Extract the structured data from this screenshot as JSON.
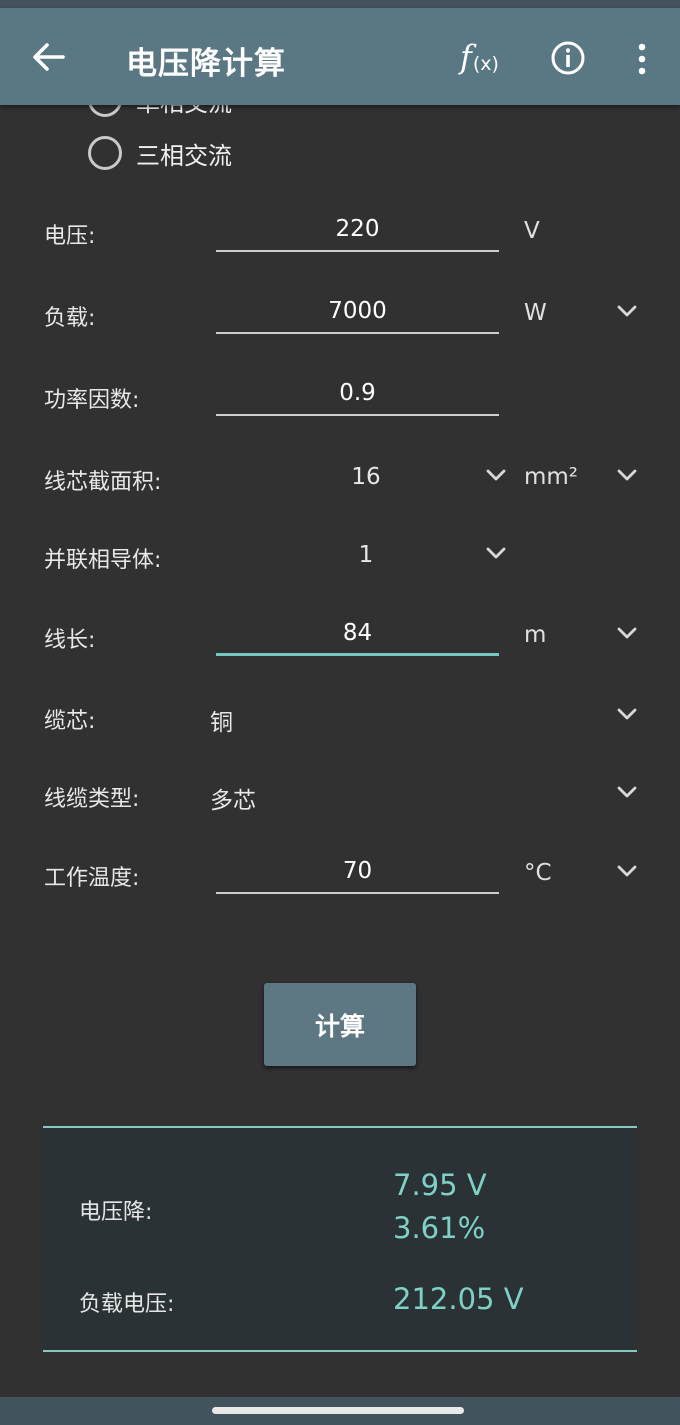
{
  "app_bar": {
    "title": "电压降计算",
    "fx_main": "f",
    "fx_sub": "(x)",
    "icons": [
      "back-arrow-icon",
      "function-icon",
      "info-icon",
      "more-vertical-icon"
    ]
  },
  "phase": {
    "options": [
      {
        "label": "单相交流",
        "selected": false
      },
      {
        "label": "三相交流",
        "selected": false
      }
    ]
  },
  "form": {
    "voltage": {
      "label": "电压:",
      "value": "220",
      "unit": "V"
    },
    "load": {
      "label": "负载:",
      "value": "7000",
      "unit": "W"
    },
    "power_factor": {
      "label": "功率因数:",
      "value": "0.9"
    },
    "cross_section": {
      "label": "线芯截面积:",
      "value": "16",
      "unit": "mm²"
    },
    "parallel": {
      "label": "并联相导体:",
      "value": "1"
    },
    "length": {
      "label": "线长:",
      "value": "84",
      "unit": "m"
    },
    "core": {
      "label": "缆芯:",
      "value": "铜"
    },
    "cable_type": {
      "label": "线缆类型:",
      "value": "多芯"
    },
    "temperature": {
      "label": "工作温度:",
      "value": "70",
      "unit": "°C"
    }
  },
  "calculate_button": "计算",
  "result": {
    "drop_label": "电压降:",
    "drop_volts": "7.95 V",
    "drop_percent": "3.61%",
    "load_voltage_label": "负载电压:",
    "load_voltage": "212.05 V"
  },
  "colors": {
    "app_bar": "#5a7784",
    "background": "#313131",
    "accent": "#74c8bf",
    "result_text": "#7fd1c6"
  }
}
